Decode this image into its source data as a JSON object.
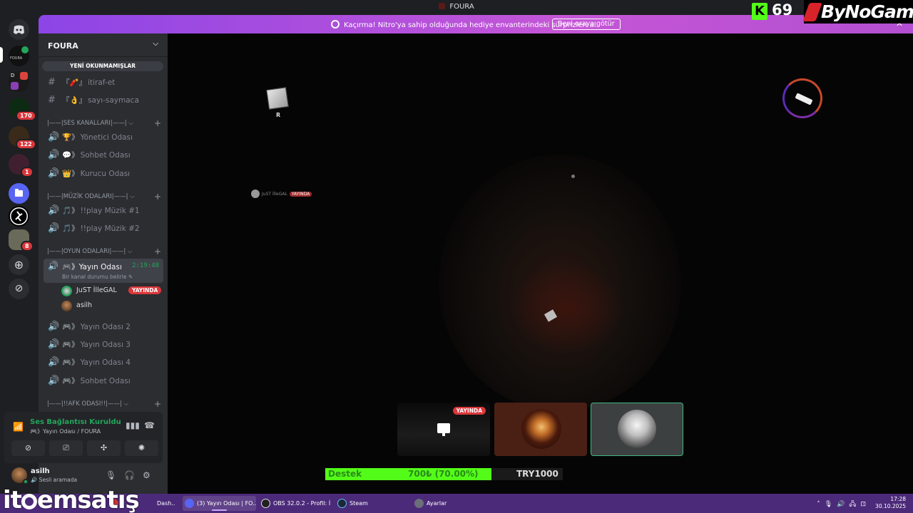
{
  "window": {
    "title": "FOURA",
    "minimize": "—",
    "maximize": "☐",
    "close": "✕"
  },
  "banner": {
    "message": "Kaçırma! Nitro'ya sahip olduğunda hediye envanterindeki sürprizleri al.",
    "button": "Beni oraya götür",
    "close": "✕"
  },
  "overlay": {
    "kick_count": "69",
    "kick_letter": "K",
    "brand": "ByNoGame"
  },
  "rail": {
    "servers": [
      {
        "label": "FOURA"
      },
      {
        "label": "D"
      },
      {
        "badge": "170"
      },
      {
        "badge": "122"
      },
      {
        "badge": "1"
      },
      {
        "badge": "8"
      }
    ]
  },
  "server": {
    "name": "FOURA",
    "unread_bar": "YENİ OKUNMAMIŞLAR",
    "text_channels": [
      {
        "deco": "『🧨』",
        "name": "itiraf-et"
      },
      {
        "deco": "『👌』",
        "name": "sayı-saymaca"
      }
    ],
    "categories": {
      "ses": "|——|SES KANALLARI|——|",
      "muzik": "|——|MÜZİK ODALARI|——|",
      "oyun": "|——|OYUN ODALARI|——|",
      "afk": "|——|!!AFK ODASI!!|——|"
    },
    "voice_channels_ses": [
      {
        "deco": "🏆》",
        "name": "Yönetici Odası"
      },
      {
        "deco": "💬》",
        "name": "Sohbet Odası"
      },
      {
        "deco": "👑》",
        "name": "Kurucu Odası"
      }
    ],
    "voice_channels_muzik": [
      {
        "deco": "🎵》",
        "name": "!!play Müzik #1"
      },
      {
        "deco": "🎵》",
        "name": "!!play Müzik #2"
      }
    ],
    "active_channel": {
      "deco": "🎮》",
      "name": "Yayın Odası",
      "timer": "2:19:48",
      "status": "Bir kanal durumu belirle ✎"
    },
    "members": [
      {
        "name": "JuST İlleGAL",
        "badge": "YAYINDA"
      },
      {
        "name": "asilh"
      }
    ],
    "voice_channels_oyun": [
      {
        "deco": "🎮》",
        "name": "Yayın Odası 2"
      },
      {
        "deco": "🎮》",
        "name": "Yayın Odası 3"
      },
      {
        "deco": "🎮》",
        "name": "Yayın Odası 4"
      },
      {
        "deco": "🎮》",
        "name": "Sohbet Odası"
      }
    ]
  },
  "voice_panel": {
    "title": "Ses Bağlantısı Kuruldu",
    "subtitle": "🎮》Yayın Odası / FOURA"
  },
  "user": {
    "name": "asilh",
    "status": "🔊 Sesli aramada"
  },
  "stream": {
    "dice_label": "R",
    "ingame_name": "JuST İlleGAL",
    "ingame_badge": "YAYINDA",
    "tile_live": "YAYINDA"
  },
  "donation": {
    "label": "Destek",
    "amount": "700₺ (70.00%)",
    "progress_fraction": 0.7,
    "goal": "TRY1000"
  },
  "watermark": {
    "before": "it",
    "after": "emsatış"
  },
  "taskbar": {
    "items": [
      {
        "label": "(3) Yayın Odası | FO..."
      },
      {
        "label": "OBS 32.0.2 - Profil: İ..."
      },
      {
        "label": "Steam"
      },
      {
        "label": "Ayarlar"
      }
    ],
    "partial": "Dash...",
    "time": "17:28",
    "date": "30.10.2025"
  },
  "colors": {
    "accent_green": "#23a55a",
    "live_red": "#da373c",
    "banner_purple": "#8c45e6",
    "kick_green": "#53fc18"
  }
}
